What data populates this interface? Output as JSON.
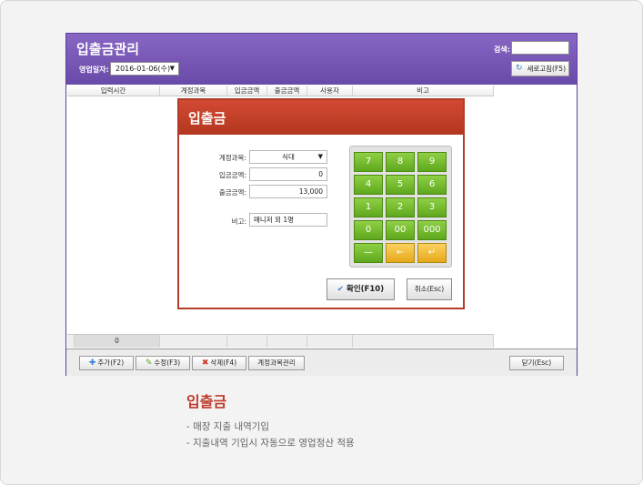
{
  "window": {
    "title": "입출금관리",
    "date_label": "영업일자:",
    "date_value": "2016-01-06(수)",
    "search_label": "검색:",
    "search_value": "",
    "refresh_label": "새로고침(F5)"
  },
  "table": {
    "columns": [
      "입력시간",
      "계정과목",
      "입금금액",
      "출금금액",
      "사용자",
      "비고"
    ],
    "footer_count": "0"
  },
  "toolbar": {
    "add": "추가(F2)",
    "edit": "수정(F3)",
    "delete": "삭제(F4)",
    "account": "계정과목관리",
    "close": "닫기(Esc)"
  },
  "dialog": {
    "title": "입출금",
    "account_label": "계정과목:",
    "account_value": "식대",
    "deposit_label": "입금금액:",
    "deposit_value": "0",
    "withdraw_label": "출금금액:",
    "withdraw_value": "13,000",
    "memo_label": "비고:",
    "memo_value": "매니저 외 1명",
    "keys": [
      "7",
      "8",
      "9",
      "4",
      "5",
      "6",
      "1",
      "2",
      "3",
      "0",
      "00",
      "000",
      "—",
      "←",
      "↵"
    ],
    "ok_label": "확인(F10)",
    "cancel_label": "취소(Esc)"
  },
  "description": {
    "title": "입출금",
    "lines": [
      "- 매장 지출 내역기입",
      "- 지출내역 기입시 자동으로 영업정산 적용"
    ]
  },
  "colors": {
    "header_purple": "#6a4aa8",
    "dialog_red": "#b3361f",
    "key_green": "#5ea81d",
    "key_yellow": "#e6a81a"
  }
}
